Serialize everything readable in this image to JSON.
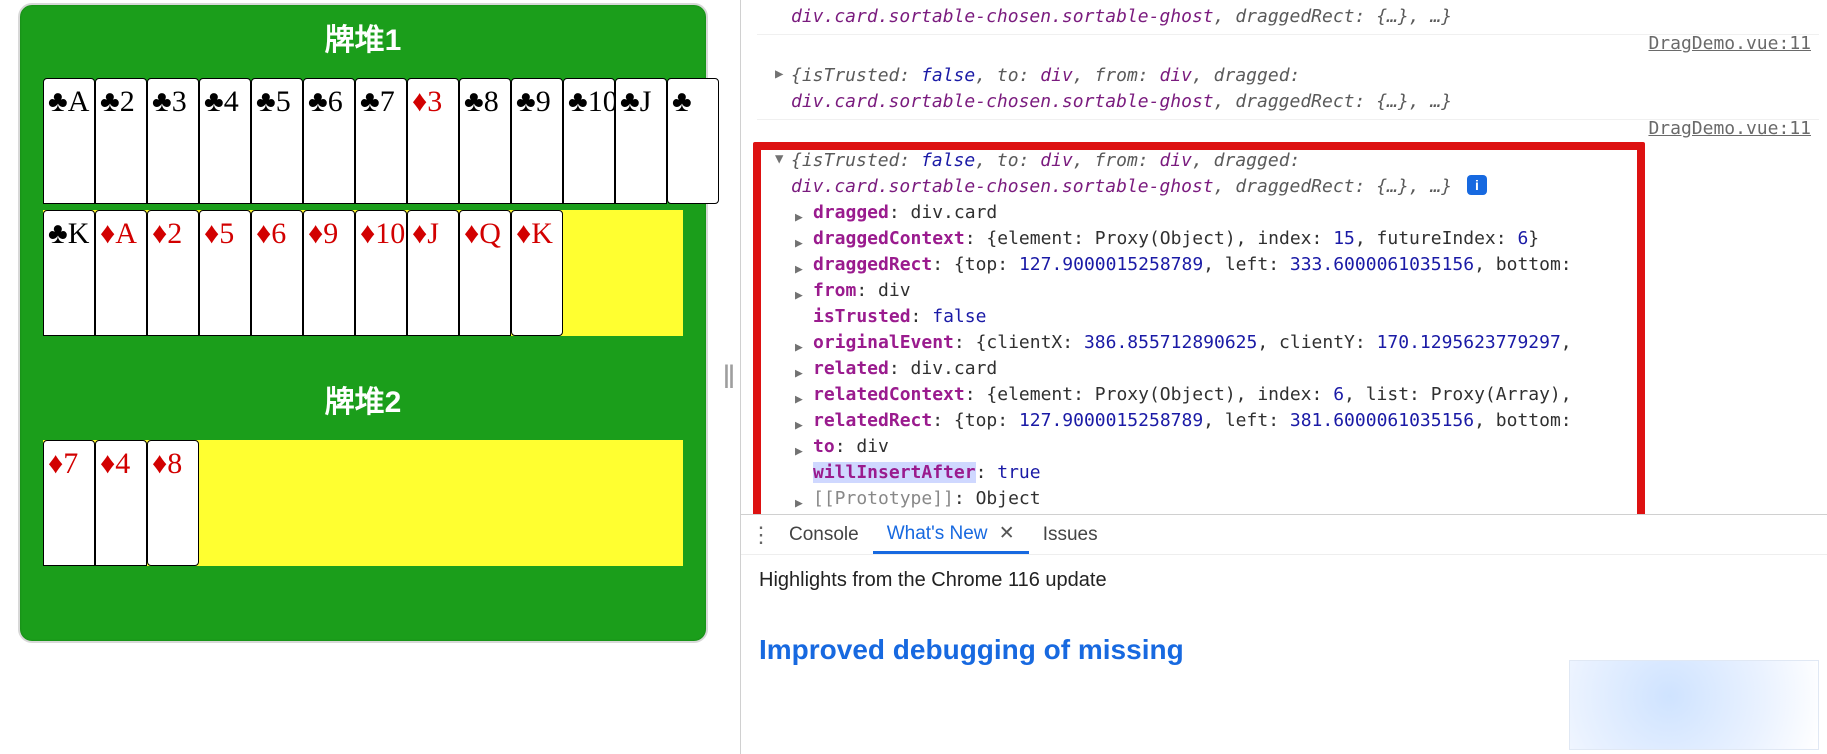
{
  "app": {
    "pile1_title": "牌堆1",
    "pile2_title": "牌堆2",
    "pile1_row1": [
      {
        "suit": "club",
        "rank": "A"
      },
      {
        "suit": "club",
        "rank": "2"
      },
      {
        "suit": "club",
        "rank": "3"
      },
      {
        "suit": "club",
        "rank": "4"
      },
      {
        "suit": "club",
        "rank": "5"
      },
      {
        "suit": "club",
        "rank": "6"
      },
      {
        "suit": "club",
        "rank": "7"
      },
      {
        "suit": "diamond",
        "rank": "3"
      },
      {
        "suit": "club",
        "rank": "8"
      },
      {
        "suit": "club",
        "rank": "9"
      },
      {
        "suit": "club",
        "rank": "10"
      },
      {
        "suit": "club",
        "rank": "J"
      },
      {
        "suit": "club",
        "rank": ""
      }
    ],
    "pile1_row2": [
      {
        "suit": "club",
        "rank": "K"
      },
      {
        "suit": "diamond",
        "rank": "A"
      },
      {
        "suit": "diamond",
        "rank": "2"
      },
      {
        "suit": "diamond",
        "rank": "5"
      },
      {
        "suit": "diamond",
        "rank": "6"
      },
      {
        "suit": "diamond",
        "rank": "9"
      },
      {
        "suit": "diamond",
        "rank": "10"
      },
      {
        "suit": "diamond",
        "rank": "J"
      },
      {
        "suit": "diamond",
        "rank": "Q"
      },
      {
        "suit": "diamond",
        "rank": "K"
      }
    ],
    "pile2_row1": [
      {
        "suit": "diamond",
        "rank": "7"
      },
      {
        "suit": "diamond",
        "rank": "4"
      },
      {
        "suit": "diamond",
        "rank": "8"
      }
    ]
  },
  "devtools": {
    "source_ref": "DragDemo.vue:11",
    "collapsed_obj_preview_l1": "{isTrusted: ",
    "collapsed_obj_preview_bool": "false",
    "collapsed_obj_preview_l1b": ", to: ",
    "collapsed_obj_preview_div": "div",
    "collapsed_obj_preview_l1c": ", from: ",
    "collapsed_obj_preview_l1d": ", dragged:",
    "collapsed_obj_preview_l2a": "div.card.sortable-chosen.sortable-ghost",
    "collapsed_obj_preview_l2b": ", draggedRect: ",
    "collapsed_obj_preview_l2c": "{…}",
    "collapsed_obj_preview_l2d": ", …}",
    "info_badge": "i",
    "props": {
      "dragged_k": "dragged",
      "dragged_v": "div.card",
      "draggedContext_k": "draggedContext",
      "draggedContext_v": "{element: Proxy(Object), index: ",
      "draggedContext_n1": "15",
      "draggedContext_mid": ", futureIndex: ",
      "draggedContext_n2": "6",
      "draggedContext_end": "}",
      "draggedRect_k": "draggedRect",
      "draggedRect_v": "{top: ",
      "draggedRect_n1": "127.9000015258789",
      "draggedRect_mid": ", left: ",
      "draggedRect_n2": "333.6000061035156",
      "draggedRect_end": ", bottom:",
      "from_k": "from",
      "from_v": "div",
      "isTrusted_k": "isTrusted",
      "isTrusted_v": "false",
      "originalEvent_k": "originalEvent",
      "originalEvent_v": "{clientX: ",
      "originalEvent_n1": "386.855712890625",
      "originalEvent_mid": ", clientY: ",
      "originalEvent_n2": "170.1295623779297",
      "originalEvent_end": ",",
      "related_k": "related",
      "related_v": "div.card",
      "relatedContext_k": "relatedContext",
      "relatedContext_v": "{element: Proxy(Object), index: ",
      "relatedContext_n1": "6",
      "relatedContext_mid": ", list: Proxy(Array),",
      "relatedRect_k": "relatedRect",
      "relatedRect_v": "{top: ",
      "relatedRect_n1": "127.9000015258789",
      "relatedRect_mid": ", left: ",
      "relatedRect_n2": "381.6000061035156",
      "relatedRect_end": ", bottom:",
      "to_k": "to",
      "to_v": "div",
      "willInsertAfter_k": "willInsertAfter",
      "willInsertAfter_v": "true",
      "proto_k": "[[Prototype]]",
      "proto_v": "Object"
    },
    "tabs": {
      "console": "Console",
      "whatsnew": "What's New",
      "issues": "Issues",
      "close": "✕"
    },
    "drawer_headline": "Highlights from the Chrome 116 update",
    "drawer_section": "Improved debugging of missing"
  },
  "splitter_glyph": "‖"
}
